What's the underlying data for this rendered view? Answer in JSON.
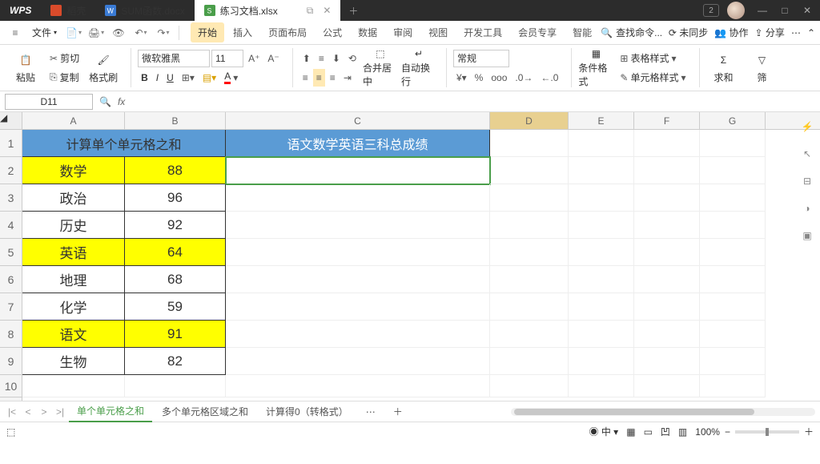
{
  "titlebar": {
    "app": "WPS",
    "tabs": [
      {
        "icon": "doc-orange",
        "label": "稻壳"
      },
      {
        "icon": "doc-blue",
        "label": "SUM函数.docx"
      },
      {
        "icon": "sheet-green",
        "label": "练习文档.xlsx",
        "active": true
      }
    ],
    "badge": "2"
  },
  "menubar": {
    "file": "文件",
    "tabs": [
      "开始",
      "插入",
      "页面布局",
      "公式",
      "数据",
      "审阅",
      "视图",
      "开发工具",
      "会员专享",
      "智能"
    ],
    "active": 0,
    "search_ph": "查找命令...",
    "right": {
      "unsync": "未同步",
      "coop": "协作",
      "share": "分享"
    }
  },
  "ribbon": {
    "paste": "粘贴",
    "cut": "剪切",
    "copy": "复制",
    "format_painter": "格式刷",
    "font": "微软雅黑",
    "size": "11",
    "merge": "合并居中",
    "wrap": "自动换行",
    "numfmt": "常规",
    "cond": "条件格式",
    "tblstyle": "表格样式",
    "cellstyle": "单元格样式",
    "sum": "求和",
    "filter": "筛"
  },
  "namebox": {
    "ref": "D11"
  },
  "columns": [
    "A",
    "B",
    "C",
    "D",
    "E",
    "F",
    "G"
  ],
  "active_col": "D",
  "table": {
    "header_left": "计算单个单元格之和",
    "header_right": "语文数学英语三科总成绩",
    "rows": [
      {
        "subj": "数学",
        "score": "88",
        "hl": true
      },
      {
        "subj": "政治",
        "score": "96"
      },
      {
        "subj": "历史",
        "score": "92"
      },
      {
        "subj": "英语",
        "score": "64",
        "hl": true
      },
      {
        "subj": "地理",
        "score": "68"
      },
      {
        "subj": "化学",
        "score": "59"
      },
      {
        "subj": "语文",
        "score": "91",
        "hl": true
      },
      {
        "subj": "生物",
        "score": "82"
      }
    ]
  },
  "sheettabs": {
    "tabs": [
      "单个单元格之和",
      "多个单元格区域之和",
      "计算得0（转格式）"
    ],
    "active": 0,
    "more": "⋯"
  },
  "status": {
    "zoom": "100%",
    "views": [
      "田",
      "口",
      "凹"
    ]
  }
}
